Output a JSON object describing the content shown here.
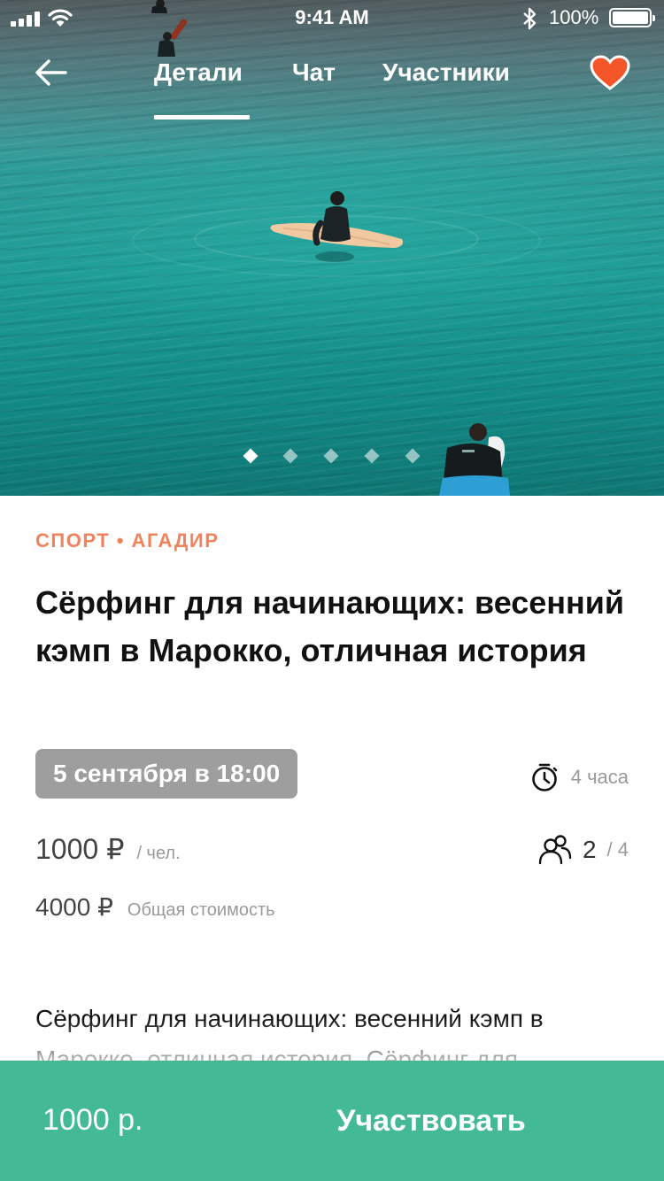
{
  "status_bar": {
    "time": "9:41 AM",
    "battery": "100%"
  },
  "nav": {
    "back_icon": "arrow-left-icon",
    "tabs": [
      {
        "label": "Детали",
        "active": true
      },
      {
        "label": "Чат",
        "active": false
      },
      {
        "label": "Участники",
        "active": false
      }
    ],
    "favorite_icon": "heart-icon",
    "favorite_color": "#f4562a"
  },
  "carousel": {
    "slide_count": 5,
    "active_index": 0
  },
  "event": {
    "category": "СПОРТ • АГАДИР",
    "title": "Сёрфинг для начинающих: весенний кэмп в Марокко, отличная история",
    "date": "5 сентября в 18:00",
    "duration": "4 часа",
    "duration_icon": "timer-icon",
    "price": "1000 ₽",
    "price_unit": "/ чел.",
    "members_icon": "people-icon",
    "members_count": "2",
    "members_max": "/ 4",
    "total_price": "4000 ₽",
    "total_label": "Общая стоимость",
    "description": "Сёрфинг для начинающих: весенний кэмп в Марокко, отличная история. Сёрфинг для"
  },
  "bottom_bar": {
    "price": "1000 р.",
    "button_label": "Участвовать",
    "color": "#43b995"
  },
  "colors": {
    "accent": "#f0825c",
    "date_chip": "#9e9e9e"
  }
}
